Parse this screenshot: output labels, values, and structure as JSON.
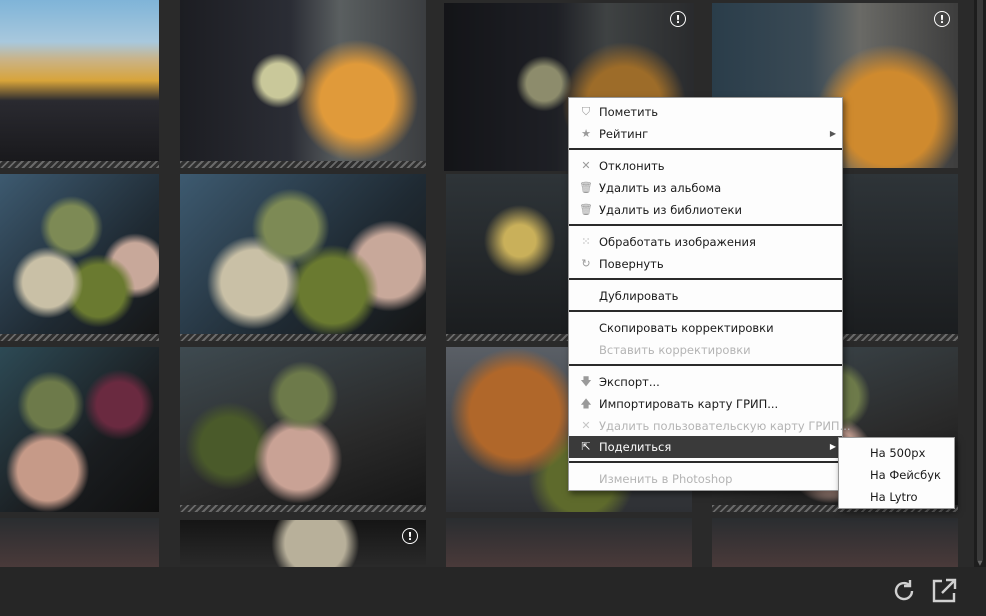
{
  "context_menu": {
    "items": [
      {
        "label": "Пометить",
        "icon": "shield-icon",
        "disabled": false
      },
      {
        "label": "Рейтинг",
        "icon": "star-icon",
        "disabled": false,
        "submenu": true
      },
      {
        "label": "Отклонить",
        "icon": "x-icon",
        "disabled": false
      },
      {
        "label": "Удалить из альбома",
        "icon": "trash-icon",
        "disabled": false
      },
      {
        "label": "Удалить из библиотеки",
        "icon": "trash-icon",
        "disabled": false
      },
      {
        "label": "Обработать изображения",
        "icon": "dots-grid-icon",
        "disabled": false
      },
      {
        "label": "Повернуть",
        "icon": "rotate-icon",
        "disabled": false
      },
      {
        "label": "Дублировать",
        "icon": "",
        "disabled": false
      },
      {
        "label": "Скопировать корректировки",
        "icon": "",
        "disabled": false
      },
      {
        "label": "Вставить корректировки",
        "icon": "",
        "disabled": true
      },
      {
        "label": "Экспорт...",
        "icon": "arrow-down-icon",
        "disabled": false
      },
      {
        "label": "Импортировать карту ГРИП...",
        "icon": "arrow-up-icon",
        "disabled": false
      },
      {
        "label": "Удалить пользовательскую карту ГРИП...",
        "icon": "x-icon",
        "disabled": true
      },
      {
        "label": "Поделиться",
        "icon": "share-icon",
        "disabled": false,
        "submenu": true,
        "highlighted": true
      },
      {
        "label": "Изменить в Photoshop",
        "icon": "",
        "disabled": true
      }
    ]
  },
  "share_submenu": {
    "items": [
      "На 500px",
      "На Фейсбук",
      "На Lytro"
    ]
  },
  "icons": {
    "warning": "!",
    "submenu_arrow": "▶",
    "refresh": "refresh-icon",
    "external": "external-link-icon"
  },
  "colors": {
    "selection": "#f0a020",
    "menu_highlight": "#3a3a3a"
  }
}
